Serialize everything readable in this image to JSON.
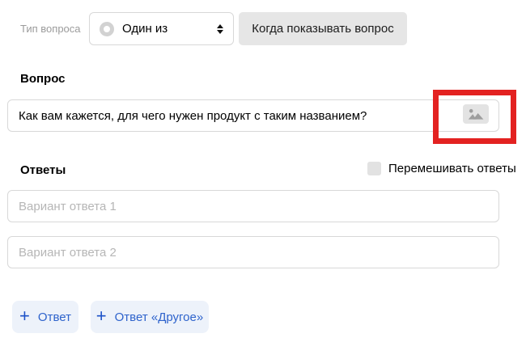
{
  "colors": {
    "accent_blue": "#2e63cc",
    "plus_blue": "#1d52c8",
    "light_blue_bg": "#edf2fa",
    "highlight_red": "#e32221",
    "gray_button_bg": "#e6e6e6",
    "image_button_bg": "#e3e3e3",
    "checkbox_bg": "#e2e2e2",
    "input_border": "#d8d8d8",
    "muted_label": "#9b9b9b",
    "placeholder": "#b6b6b6",
    "icon_gray": "#9e9e9e"
  },
  "type_row": {
    "label": "Тип вопроса",
    "select_value": "Один из",
    "condition_button_label": "Когда показывать вопрос"
  },
  "question": {
    "label": "Вопрос",
    "value": "Как вам кажется, для чего нужен продукт с таким названием?"
  },
  "answers": {
    "label": "Ответы",
    "shuffle_label": "Перемешивать ответы",
    "shuffle_checked": false,
    "options": [
      {
        "placeholder": "Вариант ответа 1",
        "value": ""
      },
      {
        "placeholder": "Вариант ответа 2",
        "value": ""
      }
    ]
  },
  "actions": {
    "plus": "+",
    "add_answer_label": "Ответ",
    "add_other_label": "Ответ «Другое»"
  }
}
